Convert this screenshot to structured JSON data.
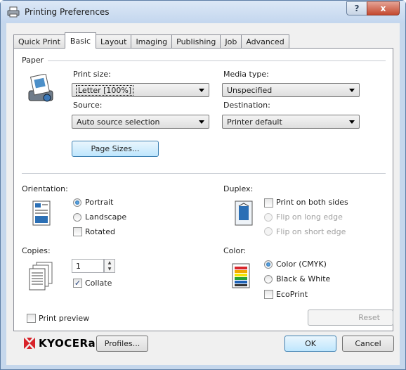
{
  "window": {
    "title": "Printing Preferences",
    "help_glyph": "?",
    "close_glyph": "x"
  },
  "tabs": [
    {
      "label": "Quick Print",
      "active": false
    },
    {
      "label": "Basic",
      "active": true
    },
    {
      "label": "Layout",
      "active": false
    },
    {
      "label": "Imaging",
      "active": false
    },
    {
      "label": "Publishing",
      "active": false
    },
    {
      "label": "Job",
      "active": false
    },
    {
      "label": "Advanced",
      "active": false
    }
  ],
  "paper": {
    "title": "Paper",
    "print_size_label": "Print size:",
    "print_size_value": "Letter  [100%]",
    "media_type_label": "Media type:",
    "media_type_value": "Unspecified",
    "source_label": "Source:",
    "source_value": "Auto source selection",
    "destination_label": "Destination:",
    "destination_value": "Printer default",
    "page_sizes_button": "Page Sizes..."
  },
  "orientation": {
    "title": "Orientation:",
    "portrait": "Portrait",
    "landscape": "Landscape",
    "rotated": "Rotated",
    "selected": "Portrait"
  },
  "duplex": {
    "title": "Duplex:",
    "print_both_sides": "Print on both sides",
    "flip_long": "Flip on long edge",
    "flip_short": "Flip on short edge"
  },
  "copies": {
    "title": "Copies:",
    "value": "1",
    "collate": "Collate",
    "collate_checked": true
  },
  "color": {
    "title": "Color:",
    "color_cmyk": "Color (CMYK)",
    "black_white": "Black & White",
    "ecoprint": "EcoPrint",
    "selected": "Color (CMYK)"
  },
  "print_preview": "Print preview",
  "reset_button": "Reset",
  "footer": {
    "brand": "KYOCERa",
    "profiles_button": "Profiles...",
    "ok_button": "OK",
    "cancel_button": "Cancel"
  },
  "colors": {
    "accent": "#3c7fb1",
    "brand": "#d8232a",
    "titlebar": "#c5d7ec",
    "close": "#c4492f"
  }
}
